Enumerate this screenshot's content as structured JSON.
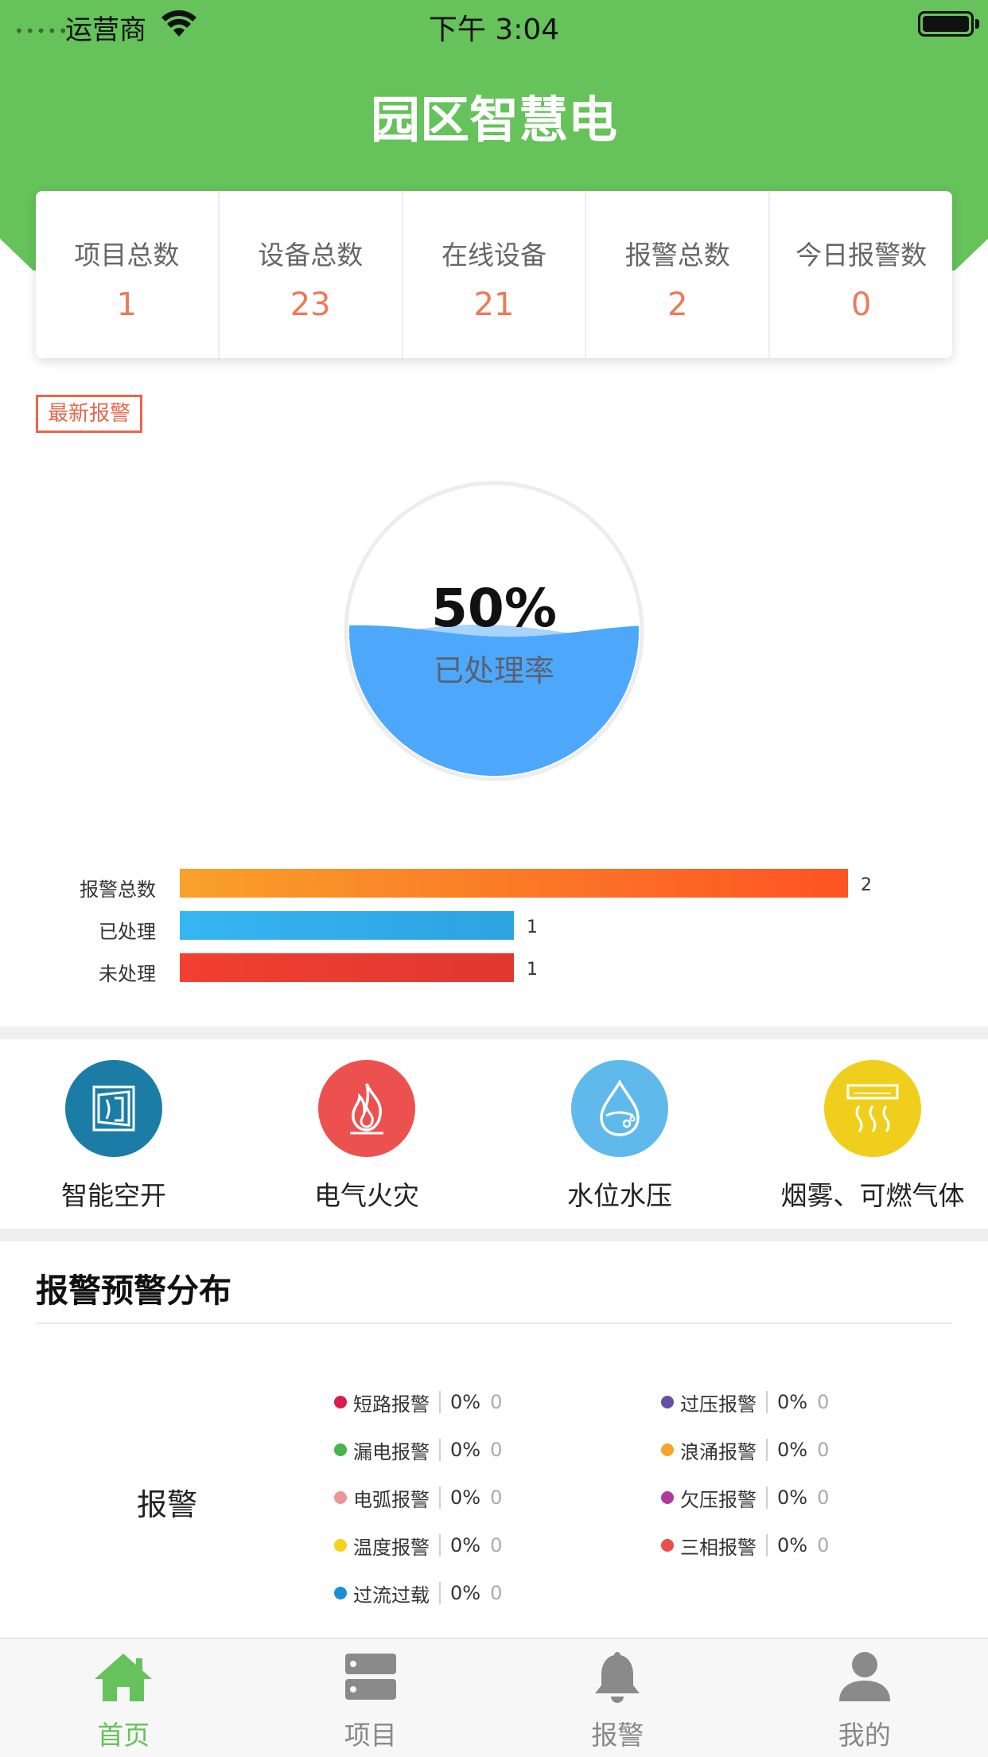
{
  "status_bar": {
    "dots": "•••••",
    "carrier": "运营商",
    "time": "下午 3:04"
  },
  "header": {
    "title": "园区智慧电"
  },
  "stats": [
    {
      "label": "项目总数",
      "value": "1"
    },
    {
      "label": "设备总数",
      "value": "23"
    },
    {
      "label": "在线设备",
      "value": "21"
    },
    {
      "label": "报警总数",
      "value": "2"
    },
    {
      "label": "今日报警数",
      "value": "0"
    }
  ],
  "latest_alarm_tag": "最新报警",
  "gauge": {
    "percent_text": "50%",
    "value": 0.5,
    "label": "已处理率",
    "water_color": "#4da8fb",
    "wave_color": "#a8d3fb"
  },
  "chart_data": {
    "type": "bar",
    "orientation": "horizontal",
    "categories": [
      "报警总数",
      "已处理",
      "未处理"
    ],
    "values": [
      2,
      1,
      1
    ],
    "xlim": [
      0,
      2
    ],
    "colors": [
      [
        "#f9a12a",
        "#fe5323"
      ],
      [
        "#35b6f2",
        "#2ea3e0"
      ],
      [
        "#f23f32",
        "#e0372f"
      ]
    ]
  },
  "categories": [
    {
      "label": "智能空开",
      "icon": "circuit-breaker-icon",
      "color": "#1b7da5"
    },
    {
      "label": "电气火灾",
      "icon": "flame-icon",
      "color": "#ec5150"
    },
    {
      "label": "水位水压",
      "icon": "water-drop-icon",
      "color": "#5fbaeb"
    },
    {
      "label": "烟雾、可燃气体",
      "icon": "smoke-detector-icon",
      "color": "#f0cf1c"
    }
  ],
  "distribution": {
    "title": "报警预警分布",
    "main_label": "报警",
    "items": [
      {
        "name": "短路报警",
        "pct": "0%",
        "count": "0",
        "color": "#d81e4a"
      },
      {
        "name": "过压报警",
        "pct": "0%",
        "count": "0",
        "color": "#6750a4"
      },
      {
        "name": "漏电报警",
        "pct": "0%",
        "count": "0",
        "color": "#45b54c"
      },
      {
        "name": "浪涌报警",
        "pct": "0%",
        "count": "0",
        "color": "#f5a52a"
      },
      {
        "name": "电弧报警",
        "pct": "0%",
        "count": "0",
        "color": "#ea9597"
      },
      {
        "name": "欠压报警",
        "pct": "0%",
        "count": "0",
        "color": "#b23a9a"
      },
      {
        "name": "温度报警",
        "pct": "0%",
        "count": "0",
        "color": "#f6d21d"
      },
      {
        "name": "三相报警",
        "pct": "0%",
        "count": "0",
        "color": "#ea4f4c"
      },
      {
        "name": "过流过载",
        "pct": "0%",
        "count": "0",
        "color": "#1a8fd8"
      }
    ]
  },
  "tabbar": {
    "accent": "#66c25a",
    "tabs": [
      {
        "label": "首页",
        "icon": "home-icon",
        "active": true
      },
      {
        "label": "项目",
        "icon": "server-icon",
        "active": false
      },
      {
        "label": "报警",
        "icon": "bell-icon",
        "active": false
      },
      {
        "label": "我的",
        "icon": "user-icon",
        "active": false
      }
    ]
  }
}
